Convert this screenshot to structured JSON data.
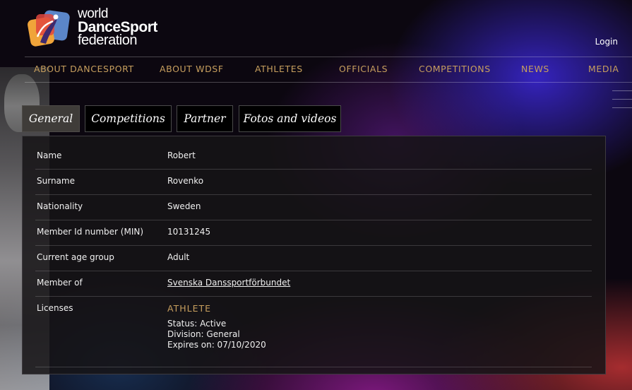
{
  "header": {
    "logo_lines": [
      "world",
      "DanceSport",
      "federation"
    ],
    "login_label": "Login"
  },
  "nav": {
    "items": [
      "ABOUT DANCESPORT",
      "ABOUT WDSF",
      "ATHLETES",
      "OFFICIALS",
      "COMPETITIONS",
      "NEWS",
      "MEDIA"
    ]
  },
  "tabs": [
    {
      "label": "General",
      "active": true
    },
    {
      "label": "Competitions",
      "active": false
    },
    {
      "label": "Partner",
      "active": false
    },
    {
      "label": "Fotos and videos",
      "active": false
    }
  ],
  "profile": {
    "rows": [
      {
        "label": "Name",
        "value": "Robert"
      },
      {
        "label": "Surname",
        "value": "Rovenko"
      },
      {
        "label": "Nationality",
        "value": "Sweden"
      },
      {
        "label": "Member Id number (MIN)",
        "value": "10131245"
      },
      {
        "label": "Current age group",
        "value": "Adult"
      },
      {
        "label": "Member of",
        "value": "Svenska Danssportförbundet"
      }
    ],
    "licenses": {
      "label": "Licenses",
      "type": "ATHLETE",
      "status": "Status: Active",
      "division": "Division: General",
      "expires": "Expires on: 07/10/2020"
    }
  },
  "colors": {
    "accent_gold": "#c79f5e",
    "panel_bg": "#161416",
    "active_tab_bg": "#3f3c39"
  }
}
